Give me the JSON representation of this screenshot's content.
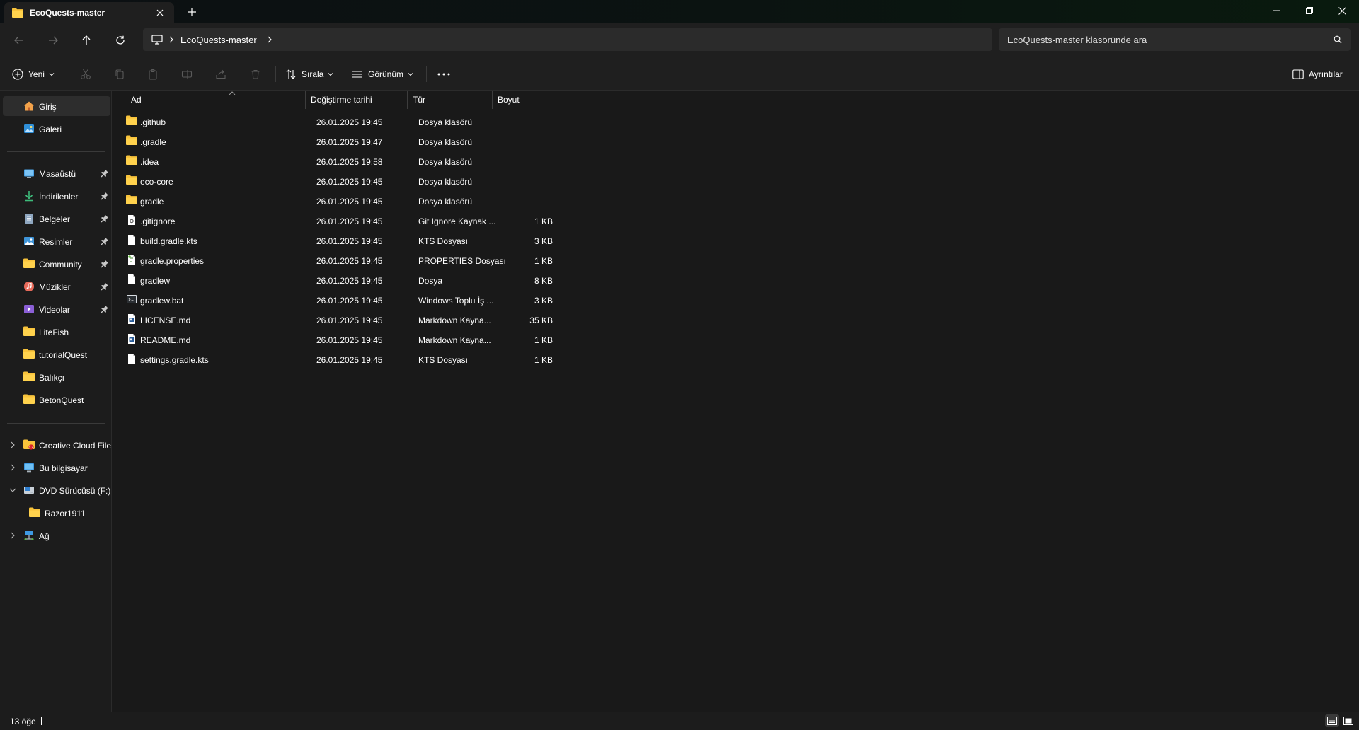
{
  "tab": {
    "title": "EcoQuests-master"
  },
  "address": {
    "crumbs": [
      "EcoQuests-master"
    ]
  },
  "search": {
    "placeholder": "EcoQuests-master klasöründe ara"
  },
  "commands": {
    "new_label": "Yeni",
    "sort_label": "Sırala",
    "view_label": "Görünüm",
    "details_label": "Ayrıntılar"
  },
  "sidebar": {
    "home": [
      {
        "label": "Giriş",
        "icon": "home-icon"
      },
      {
        "label": "Galeri",
        "icon": "gallery-icon"
      }
    ],
    "quick": [
      {
        "label": "Masaüstü",
        "icon": "desktop-icon",
        "pinned": true
      },
      {
        "label": "İndirilenler",
        "icon": "download-icon",
        "pinned": true
      },
      {
        "label": "Belgeler",
        "icon": "documents-icon",
        "pinned": true
      },
      {
        "label": "Resimler",
        "icon": "pictures-icon",
        "pinned": true
      },
      {
        "label": "Community",
        "icon": "folder-icon",
        "pinned": true
      },
      {
        "label": "Müzikler",
        "icon": "music-icon",
        "pinned": true
      },
      {
        "label": "Videolar",
        "icon": "videos-icon",
        "pinned": true
      },
      {
        "label": "LiteFish",
        "icon": "folder-icon",
        "pinned": false
      },
      {
        "label": "tutorialQuest",
        "icon": "folder-icon",
        "pinned": false
      },
      {
        "label": "Balıkçı",
        "icon": "folder-icon",
        "pinned": false
      },
      {
        "label": "BetonQuest",
        "icon": "folder-icon",
        "pinned": false
      }
    ],
    "tree": [
      {
        "label": "Creative Cloud Files",
        "icon": "creative-cloud-icon",
        "expanded": false
      },
      {
        "label": "Bu bilgisayar",
        "icon": "this-pc-icon",
        "expanded": false
      },
      {
        "label": "DVD Sürücüsü (F:) C",
        "icon": "dvd-drive-icon",
        "expanded": true
      },
      {
        "label": "Razor1911",
        "icon": "folder-icon",
        "child": true
      },
      {
        "label": "Ağ",
        "icon": "network-icon",
        "expanded": false
      }
    ]
  },
  "columns": {
    "name": "Ad",
    "date": "Değiştirme tarihi",
    "type": "Tür",
    "size": "Boyut"
  },
  "files": [
    {
      "name": ".github",
      "date": "26.01.2025 19:45",
      "type": "Dosya klasörü",
      "size": "",
      "icon": "folder"
    },
    {
      "name": ".gradle",
      "date": "26.01.2025 19:47",
      "type": "Dosya klasörü",
      "size": "",
      "icon": "folder"
    },
    {
      "name": ".idea",
      "date": "26.01.2025 19:58",
      "type": "Dosya klasörü",
      "size": "",
      "icon": "folder"
    },
    {
      "name": "eco-core",
      "date": "26.01.2025 19:45",
      "type": "Dosya klasörü",
      "size": "",
      "icon": "folder"
    },
    {
      "name": "gradle",
      "date": "26.01.2025 19:45",
      "type": "Dosya klasörü",
      "size": "",
      "icon": "folder"
    },
    {
      "name": ".gitignore",
      "date": "26.01.2025 19:45",
      "type": "Git Ignore Kaynak ...",
      "size": "1 KB",
      "icon": "text"
    },
    {
      "name": "build.gradle.kts",
      "date": "26.01.2025 19:45",
      "type": "KTS Dosyası",
      "size": "3 KB",
      "icon": "blank"
    },
    {
      "name": "gradle.properties",
      "date": "26.01.2025 19:45",
      "type": "PROPERTIES Dosyası",
      "size": "1 KB",
      "icon": "config"
    },
    {
      "name": "gradlew",
      "date": "26.01.2025 19:45",
      "type": "Dosya",
      "size": "8 KB",
      "icon": "blank"
    },
    {
      "name": "gradlew.bat",
      "date": "26.01.2025 19:45",
      "type": "Windows Toplu İş ...",
      "size": "3 KB",
      "icon": "batch"
    },
    {
      "name": "LICENSE.md",
      "date": "26.01.2025 19:45",
      "type": "Markdown Kayna...",
      "size": "35 KB",
      "icon": "markdown"
    },
    {
      "name": "README.md",
      "date": "26.01.2025 19:45",
      "type": "Markdown Kayna...",
      "size": "1 KB",
      "icon": "markdown"
    },
    {
      "name": "settings.gradle.kts",
      "date": "26.01.2025 19:45",
      "type": "KTS Dosyası",
      "size": "1 KB",
      "icon": "blank"
    }
  ],
  "status": {
    "count": "13 öğe"
  },
  "colors": {
    "folder": "#f8c33b",
    "background": "#191919",
    "chrome": "#1f1f1f"
  }
}
